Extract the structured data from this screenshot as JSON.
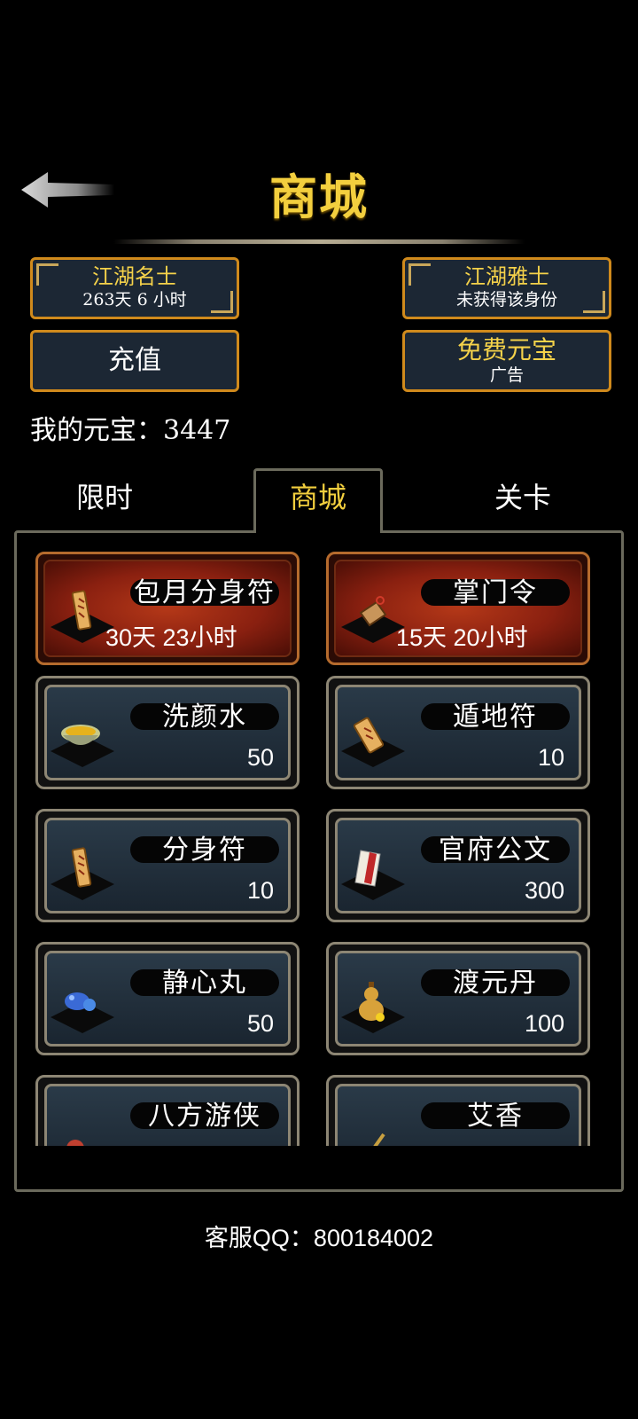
{
  "header": {
    "title": "商城"
  },
  "badges": [
    {
      "title": "江湖名士",
      "sub": "263天 6 小时"
    },
    {
      "title": "江湖雅士",
      "sub": "未获得该身份"
    }
  ],
  "buttons": {
    "recharge": "充值",
    "free_title": "免费元宝",
    "free_sub": "广告"
  },
  "balance": "我的元宝：3447",
  "tabs": [
    "限时",
    "商城",
    "关卡"
  ],
  "active_tab": "商城",
  "items": [
    {
      "name": "包月分身符",
      "time": "30天 23小时",
      "icon": "talisman-icon"
    },
    {
      "name": "掌门令",
      "time": "15天 20小时",
      "icon": "token-icon"
    },
    {
      "name": "洗颜水",
      "price": "50",
      "icon": "bowl-icon"
    },
    {
      "name": "遁地符",
      "price": "10",
      "icon": "talisman-icon"
    },
    {
      "name": "分身符",
      "price": "10",
      "icon": "talisman-icon"
    },
    {
      "name": "官府公文",
      "price": "300",
      "icon": "document-icon"
    },
    {
      "name": "静心丸",
      "price": "50",
      "icon": "pills-icon"
    },
    {
      "name": "渡元丹",
      "price": "100",
      "icon": "gourd-icon"
    },
    {
      "name": "八方游侠",
      "price": "",
      "icon": "hero-icon"
    },
    {
      "name": "艾香",
      "price": "",
      "icon": "incense-icon"
    }
  ],
  "footer": "客服QQ：800184002",
  "colors": {
    "gold": "#f3cf3e",
    "orange_border": "#d08a1c",
    "panel_border": "#6b6a5c"
  }
}
